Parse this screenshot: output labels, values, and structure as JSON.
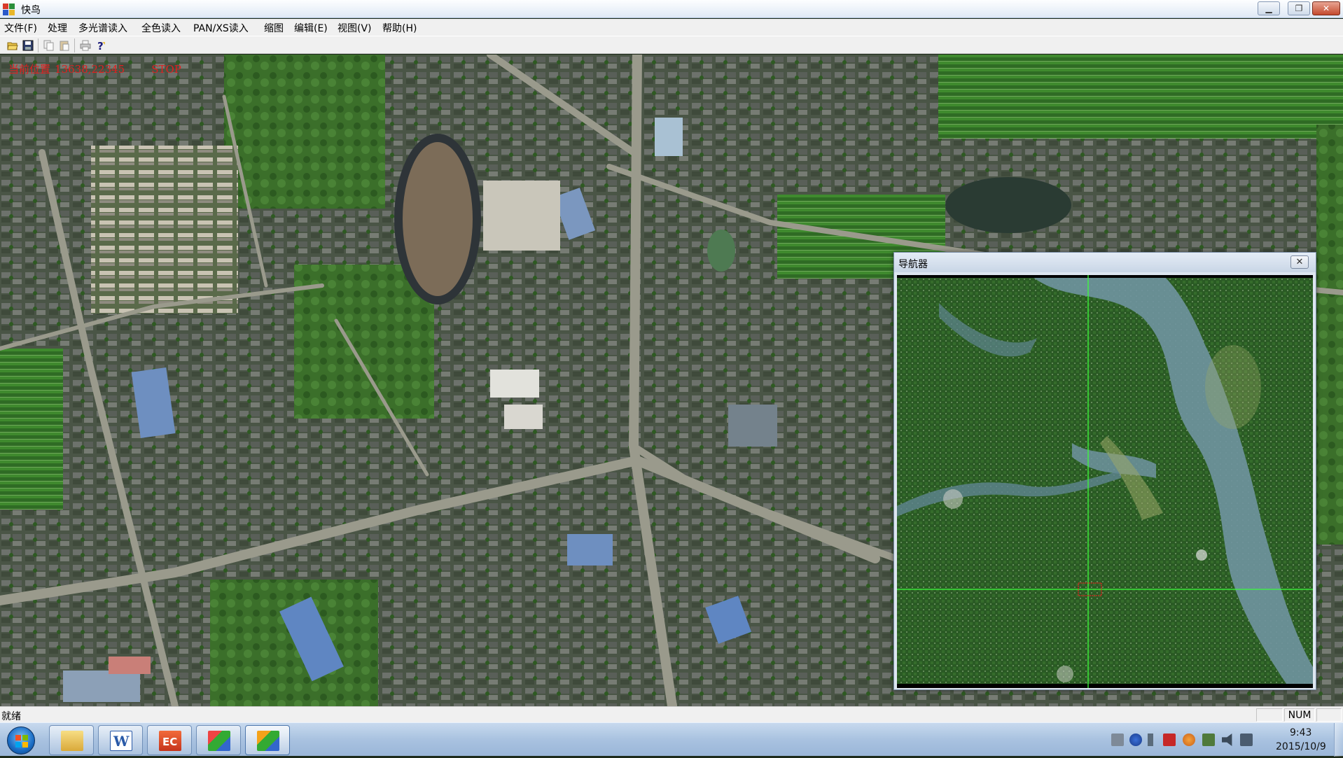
{
  "window": {
    "title": "快鸟",
    "minimize_label": "▁",
    "restore_label": "❐",
    "close_label": "✕"
  },
  "menu": {
    "items": [
      "文件(F)",
      "处理",
      "多光谱读入",
      "全色读入",
      "PAN/XS读入",
      "缩图",
      "编辑(E)",
      "视图(V)",
      "帮助(H)"
    ]
  },
  "toolbar": {
    "icons": [
      "open-icon",
      "save-icon",
      "copy-icon",
      "paste-icon",
      "print-icon",
      "help-icon"
    ]
  },
  "map": {
    "position_label": "当前位置",
    "coordinates": "13638,22345",
    "stop_label": "STOP"
  },
  "navigator": {
    "title": "导航器",
    "close_label": "✕"
  },
  "statusbar": {
    "status": "就绪",
    "num_indicator": "NUM"
  },
  "taskbar": {
    "apps": [
      "file-explorer-icon",
      "word-icon",
      "ec-app-icon",
      "mfc-app-icon",
      "mfc-app-icon-2"
    ],
    "time": "9:43",
    "date": "2015/10/9"
  },
  "colors": {
    "title_bg": "#dfe9f5",
    "readout_red": "#e02020",
    "navigator_crosshair": "#3cff3c"
  }
}
